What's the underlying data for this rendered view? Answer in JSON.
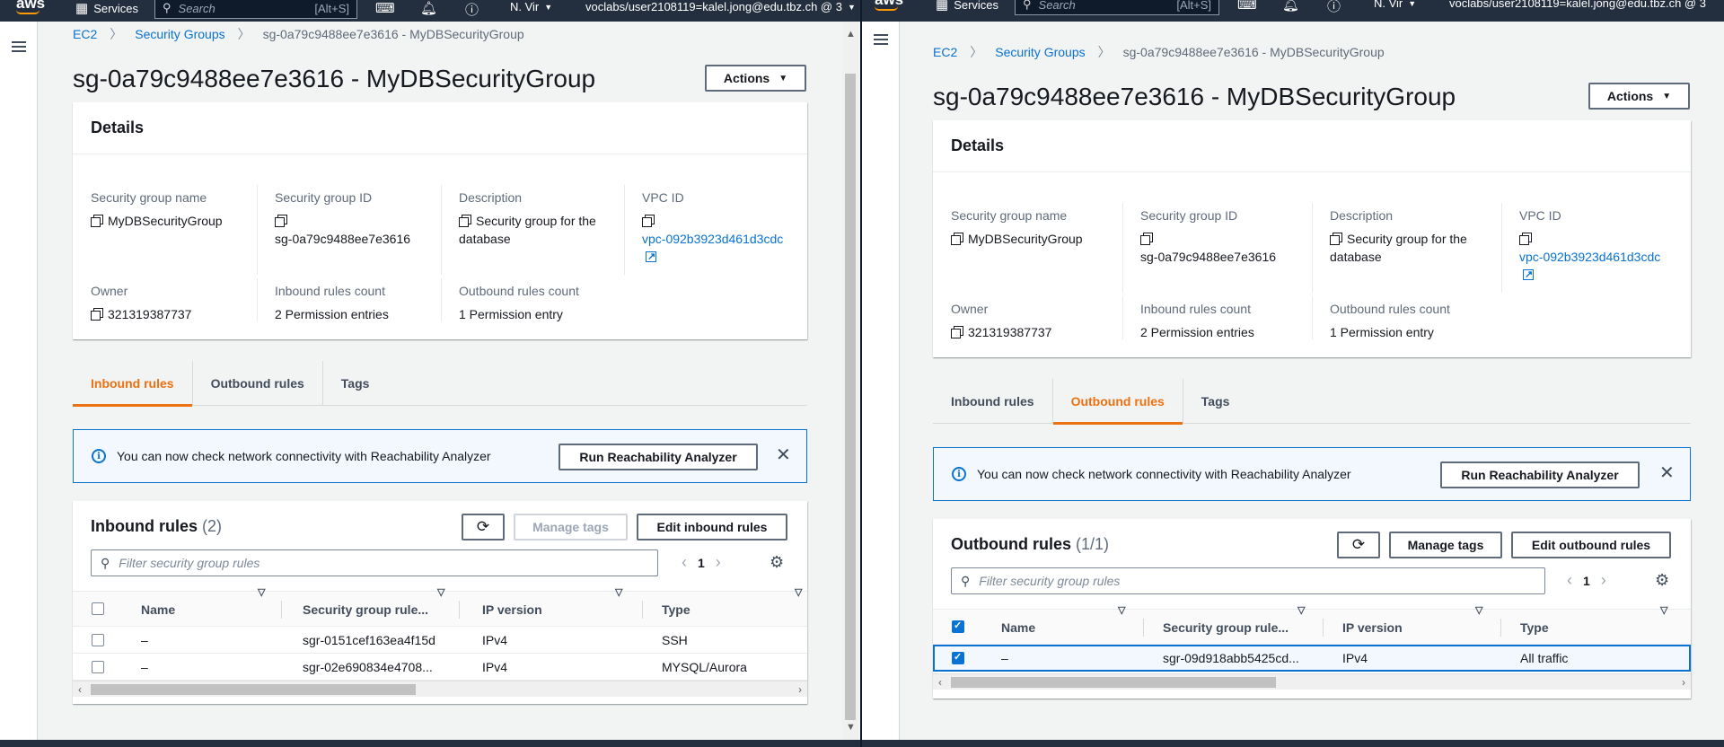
{
  "nav": {
    "logo": "aws",
    "services": "Services",
    "search_placeholder": "Search",
    "search_shortcut": "[Alt+S]",
    "region": "N. Vir",
    "account": "voclabs/user2108119=kalel.jong@edu.tbz.ch @ 3",
    "icons": [
      "apps-grid-icon",
      "cloudshell-icon",
      "bell-icon",
      "help-icon"
    ]
  },
  "breadcrumb": {
    "ec2": "EC2",
    "security_groups": "Security Groups",
    "current": "sg-0a79c9488ee7e3616 - MyDBSecurityGroup"
  },
  "page_title": "sg-0a79c9488ee7e3616 - MyDBSecurityGroup",
  "actions_label": "Actions",
  "details": {
    "heading": "Details",
    "sg_name_label": "Security group name",
    "sg_name": "MyDBSecurityGroup",
    "sg_id_label": "Security group ID",
    "sg_id": "sg-0a79c9488ee7e3616",
    "description_label": "Description",
    "description": "Security group for the database",
    "vpc_label": "VPC ID",
    "vpc_id": "vpc-092b3923d461d3cdc",
    "owner_label": "Owner",
    "owner": "321319387737",
    "inbound_count_label": "Inbound rules count",
    "inbound_count": "2 Permission entries",
    "outbound_count_label": "Outbound rules count",
    "outbound_count": "1 Permission entry"
  },
  "tabs": {
    "inbound": "Inbound rules",
    "outbound": "Outbound rules",
    "tags": "Tags"
  },
  "alert": {
    "text": "You can now check network connectivity with Reachability Analyzer",
    "button": "Run Reachability Analyzer"
  },
  "left_panel": {
    "title": "Inbound rules",
    "count": "(2)",
    "manage_tags": "Manage tags",
    "edit_button": "Edit inbound rules",
    "filter_placeholder": "Filter security group rules",
    "page": "1",
    "columns": [
      "Name",
      "Security group rule...",
      "IP version",
      "Type"
    ],
    "rows": [
      {
        "name": "–",
        "rule_id": "sgr-0151cef163ea4f15d",
        "ip_version": "IPv4",
        "type": "SSH"
      },
      {
        "name": "–",
        "rule_id": "sgr-02e690834e4708...",
        "ip_version": "IPv4",
        "type": "MYSQL/Aurora"
      }
    ]
  },
  "right_panel": {
    "title": "Outbound rules",
    "count": "(1/1)",
    "manage_tags": "Manage tags",
    "edit_button": "Edit outbound rules",
    "filter_placeholder": "Filter security group rules",
    "page": "1",
    "columns": [
      "Name",
      "Security group rule...",
      "IP version",
      "Type"
    ],
    "rows": [
      {
        "name": "–",
        "rule_id": "sgr-09d918abb5425cd...",
        "ip_version": "IPv4",
        "type": "All traffic"
      }
    ]
  },
  "colors": {
    "nav_bg": "#232f3e",
    "link": "#0972d3",
    "active_tab": "#ec7211",
    "page_bg": "#f2f3f3"
  }
}
